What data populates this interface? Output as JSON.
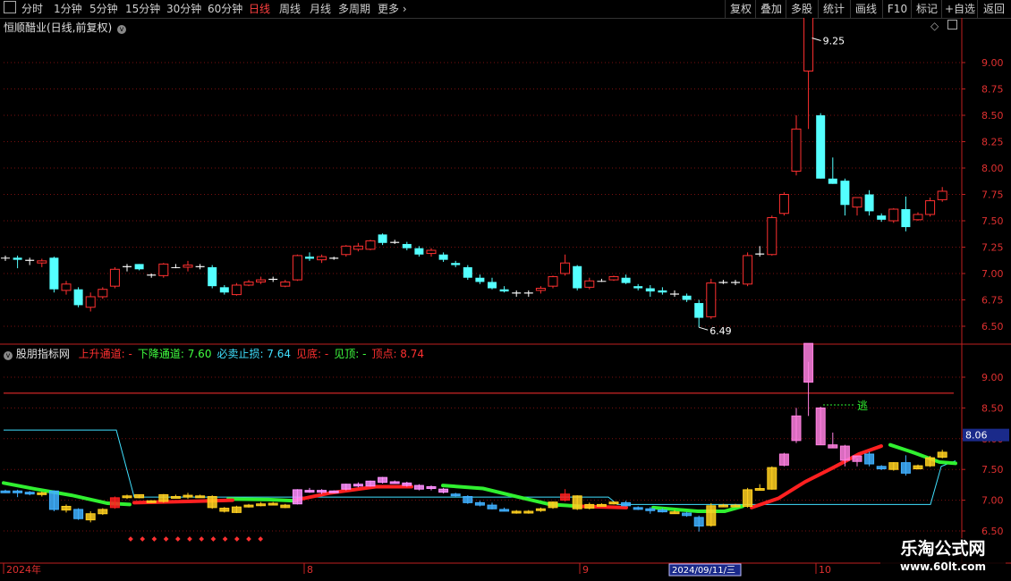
{
  "toolbar": {
    "periods": [
      "分时",
      "1分钟",
      "5分钟",
      "15分钟",
      "30分钟",
      "60分钟",
      "日线",
      "周线",
      "月线",
      "多周期",
      "更多"
    ],
    "active_period": "日线",
    "more_chevron": "›",
    "right_buttons": [
      "复权",
      "叠加",
      "多股",
      "统计",
      "画线",
      "F10",
      "+自选",
      "返回"
    ]
  },
  "main_panel": {
    "title": "恒顺醋业(日线,前复权)",
    "high_label": "9.25",
    "low_label": "6.49",
    "y_ticks": [
      "9.00",
      "8.75",
      "8.50",
      "8.25",
      "8.00",
      "7.75",
      "7.50",
      "7.25",
      "7.00",
      "6.75",
      "6.50"
    ],
    "y_values": [
      9.0,
      8.75,
      8.5,
      8.25,
      8.0,
      7.75,
      7.5,
      7.25,
      7.0,
      6.75,
      6.5
    ]
  },
  "indicator_panel": {
    "name": "股朋指标网",
    "items": [
      {
        "label": "上升通道:",
        "value": "-",
        "color": "#ff3030"
      },
      {
        "label": "下降通道:",
        "value": "7.60",
        "color": "#40ff40"
      },
      {
        "label": "必卖止损:",
        "value": "7.64",
        "color": "#40e0ff"
      },
      {
        "label": "见底:",
        "value": "-",
        "color": "#ff3030"
      },
      {
        "label": "见顶:",
        "value": "-",
        "color": "#40ff40"
      },
      {
        "label": "顶点:",
        "value": "8.74",
        "color": "#ff3030"
      }
    ],
    "annotation": "逃",
    "current_value": "8.06",
    "y_ticks": [
      "9.00",
      "8.50",
      "8.00",
      "7.50",
      "7.00",
      "6.50"
    ],
    "y_values": [
      9.0,
      8.5,
      8.0,
      7.5,
      7.0,
      6.5
    ]
  },
  "time_axis": {
    "labels": [
      "2024年",
      "8",
      "9",
      "10"
    ],
    "cursor_date": "2024/09/11/三"
  },
  "watermark": {
    "title": "乐淘公式网",
    "url": "www.60lt.com"
  },
  "colors": {
    "up": "#ff3030",
    "down": "#54ffff",
    "flat": "#ffffff",
    "grid": "#7a1010",
    "axis": "#c02020"
  },
  "candles": [
    [
      7.15,
      7.17,
      7.12,
      7.15
    ],
    [
      7.15,
      7.17,
      7.05,
      7.13
    ],
    [
      7.13,
      7.15,
      7.08,
      7.12
    ],
    [
      7.1,
      7.14,
      7.06,
      7.12
    ],
    [
      7.15,
      7.16,
      6.82,
      6.85
    ],
    [
      6.84,
      6.93,
      6.8,
      6.9
    ],
    [
      6.85,
      6.87,
      6.68,
      6.7
    ],
    [
      6.68,
      6.82,
      6.64,
      6.78
    ],
    [
      6.78,
      6.87,
      6.76,
      6.85
    ],
    [
      6.88,
      7.06,
      6.86,
      7.04
    ],
    [
      7.07,
      7.09,
      7.02,
      7.06
    ],
    [
      7.09,
      7.09,
      7.03,
      7.04
    ],
    [
      6.98,
      7.0,
      6.96,
      6.99
    ],
    [
      6.98,
      7.1,
      6.96,
      7.09
    ],
    [
      7.06,
      7.09,
      7.05,
      7.06
    ],
    [
      7.06,
      7.12,
      7.02,
      7.08
    ],
    [
      7.07,
      7.09,
      7.04,
      7.06
    ],
    [
      7.06,
      7.08,
      6.86,
      6.88
    ],
    [
      6.87,
      6.89,
      6.8,
      6.82
    ],
    [
      6.8,
      6.91,
      6.79,
      6.89
    ],
    [
      6.89,
      6.94,
      6.88,
      6.92
    ],
    [
      6.92,
      6.97,
      6.9,
      6.94
    ],
    [
      6.94,
      6.97,
      6.92,
      6.95
    ],
    [
      6.88,
      6.94,
      6.87,
      6.92
    ],
    [
      6.94,
      7.18,
      6.93,
      7.17
    ],
    [
      7.16,
      7.2,
      7.12,
      7.14
    ],
    [
      7.13,
      7.18,
      7.1,
      7.16
    ],
    [
      7.14,
      7.16,
      7.13,
      7.15
    ],
    [
      7.18,
      7.27,
      7.16,
      7.26
    ],
    [
      7.23,
      7.29,
      7.21,
      7.26
    ],
    [
      7.23,
      7.32,
      7.22,
      7.31
    ],
    [
      7.37,
      7.38,
      7.27,
      7.29
    ],
    [
      7.29,
      7.32,
      7.28,
      7.3
    ],
    [
      7.28,
      7.3,
      7.22,
      7.24
    ],
    [
      7.24,
      7.26,
      7.16,
      7.18
    ],
    [
      7.19,
      7.24,
      7.16,
      7.22
    ],
    [
      7.18,
      7.2,
      7.11,
      7.13
    ],
    [
      7.1,
      7.12,
      7.06,
      7.08
    ],
    [
      7.06,
      7.08,
      6.94,
      6.96
    ],
    [
      6.96,
      6.99,
      6.9,
      6.92
    ],
    [
      6.92,
      6.96,
      6.85,
      6.86
    ],
    [
      6.85,
      6.88,
      6.82,
      6.83
    ],
    [
      6.81,
      6.84,
      6.78,
      6.82
    ],
    [
      6.81,
      6.84,
      6.78,
      6.82
    ],
    [
      6.84,
      6.88,
      6.81,
      6.86
    ],
    [
      6.88,
      6.98,
      6.86,
      6.97
    ],
    [
      7.0,
      7.18,
      6.98,
      7.1
    ],
    [
      7.07,
      7.08,
      6.84,
      6.86
    ],
    [
      6.87,
      6.96,
      6.85,
      6.93
    ],
    [
      6.93,
      6.95,
      6.92,
      6.93
    ],
    [
      6.94,
      6.98,
      6.93,
      6.97
    ],
    [
      6.96,
      6.99,
      6.9,
      6.91
    ],
    [
      6.88,
      6.9,
      6.84,
      6.86
    ],
    [
      6.86,
      6.89,
      6.78,
      6.83
    ],
    [
      6.84,
      6.87,
      6.8,
      6.82
    ],
    [
      6.8,
      6.84,
      6.78,
      6.81
    ],
    [
      6.79,
      6.81,
      6.73,
      6.75
    ],
    [
      6.72,
      6.75,
      6.49,
      6.58
    ],
    [
      6.59,
      6.95,
      6.57,
      6.91
    ],
    [
      6.91,
      6.94,
      6.9,
      6.92
    ],
    [
      6.91,
      6.94,
      6.89,
      6.92
    ],
    [
      6.9,
      7.2,
      6.88,
      7.17
    ],
    [
      7.18,
      7.26,
      7.16,
      7.19
    ],
    [
      7.18,
      7.55,
      7.17,
      7.53
    ],
    [
      7.57,
      7.77,
      7.55,
      7.75
    ],
    [
      7.97,
      8.5,
      7.93,
      8.37
    ],
    [
      8.92,
      9.25,
      8.37,
      9.55
    ],
    [
      8.5,
      8.52,
      7.9,
      7.9
    ],
    [
      7.9,
      8.1,
      7.85,
      7.85
    ],
    [
      7.88,
      7.9,
      7.55,
      7.65
    ],
    [
      7.63,
      7.68,
      7.55,
      7.72
    ],
    [
      7.75,
      7.79,
      7.55,
      7.59
    ],
    [
      7.55,
      7.57,
      7.49,
      7.51
    ],
    [
      7.5,
      7.62,
      7.48,
      7.61
    ],
    [
      7.61,
      7.73,
      7.4,
      7.44
    ],
    [
      7.51,
      7.58,
      7.5,
      7.56
    ],
    [
      7.56,
      7.72,
      7.54,
      7.69
    ],
    [
      7.7,
      7.82,
      7.68,
      7.78
    ]
  ]
}
